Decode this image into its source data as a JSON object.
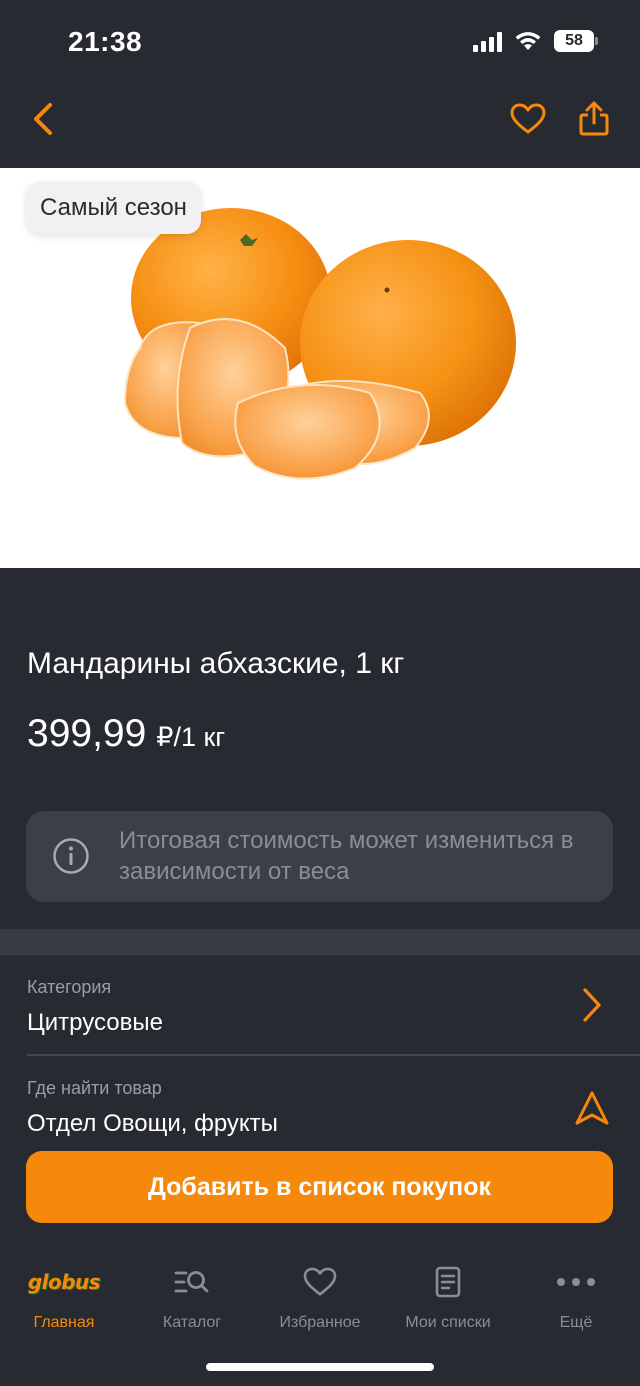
{
  "status_bar": {
    "time": "21:38",
    "battery": "58"
  },
  "nav": {
    "back_icon": "chevron-left-icon",
    "favorite_icon": "heart-icon",
    "share_icon": "share-icon"
  },
  "hero": {
    "badge": "Самый сезон",
    "image": "tangerines-photo"
  },
  "product": {
    "title": "Мандарины абхазские, 1 кг",
    "price_value": "399,99",
    "price_unit": "₽/1 кг"
  },
  "info": {
    "icon": "info-icon",
    "text": "Итоговая стоимость может измениться в зависимости от веса"
  },
  "category": {
    "label": "Категория",
    "value": "Цитрусовые"
  },
  "location": {
    "label": "Где найти товар",
    "value": "Отдел Овощи, фрукты"
  },
  "add_button": {
    "label": "Добавить в список покупок"
  },
  "tabs": [
    {
      "label": "Главная",
      "logo": "globus",
      "active": true
    },
    {
      "label": "Каталог",
      "icon": "catalog-search-icon"
    },
    {
      "label": "Избранное",
      "icon": "heart-icon"
    },
    {
      "label": "Мои списки",
      "icon": "list-icon"
    },
    {
      "label": "Ещё",
      "icon": "more-icon"
    }
  ],
  "colors": {
    "accent": "#f6890c",
    "background": "#282a31",
    "card": "#3d3f48",
    "muted_text": "#8b8d95"
  }
}
